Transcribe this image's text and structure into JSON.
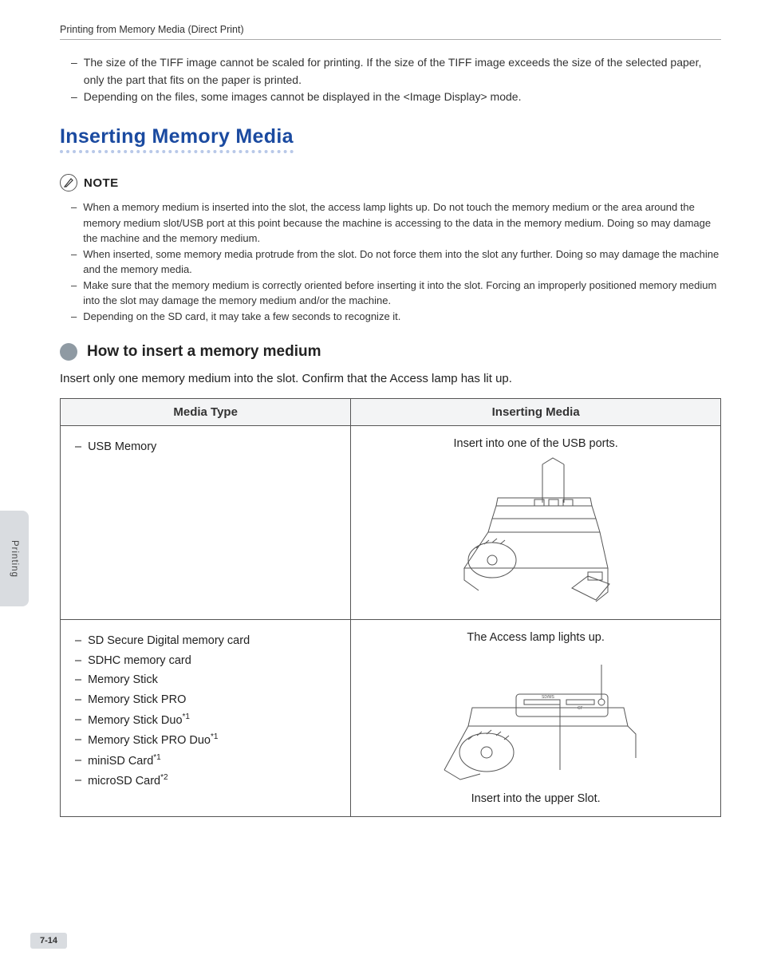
{
  "breadcrumb": "Printing from Memory Media (Direct Print)",
  "top_notes": [
    "The size of the TIFF image cannot be scaled for printing. If the size of the TIFF image exceeds the size of the selected paper, only the part that fits on the paper is printed.",
    "Depending on the files, some images cannot be displayed in the <Image Display> mode."
  ],
  "section_title": "Inserting Memory Media",
  "note_label": "NOTE",
  "notes": [
    "When a memory medium is inserted into the slot, the access lamp lights up. Do not touch the memory medium or the area around the memory medium slot/USB port at this point because the machine is accessing to the data in the memory medium. Doing so may damage the machine and the memory medium.",
    "When inserted, some memory media protrude from the slot. Do not force them into the slot any further. Doing so may damage the machine and the memory media.",
    "Make sure that the memory medium is correctly oriented before inserting it into the slot. Forcing an improperly positioned memory medium into the slot may damage the memory medium and/or the machine.",
    "Depending on the SD card, it may take a few seconds to recognize it."
  ],
  "subhead": "How to insert a memory medium",
  "intro": "Insert only one memory medium into the slot. Confirm that the Access lamp has lit up.",
  "table": {
    "headers": [
      "Media Type",
      "Inserting Media"
    ],
    "rows": [
      {
        "media_plain": [
          "USB Memory"
        ],
        "media_sup": [],
        "caption_top": "Insert into one of the USB ports.",
        "caption_bottom": ""
      },
      {
        "media_plain": [
          "SD Secure Digital memory card",
          "SDHC memory card",
          "Memory Stick",
          "Memory Stick PRO"
        ],
        "media_sup": [
          {
            "label": "Memory Stick Duo",
            "sup": "*1"
          },
          {
            "label": "Memory Stick PRO Duo",
            "sup": "*1"
          },
          {
            "label": "miniSD Card",
            "sup": "*1"
          },
          {
            "label": "microSD Card",
            "sup": "*2"
          }
        ],
        "caption_top": "The Access lamp lights up.",
        "caption_bottom": "Insert into the upper Slot."
      }
    ]
  },
  "side_tab": "Printing",
  "page_num": "7-14"
}
